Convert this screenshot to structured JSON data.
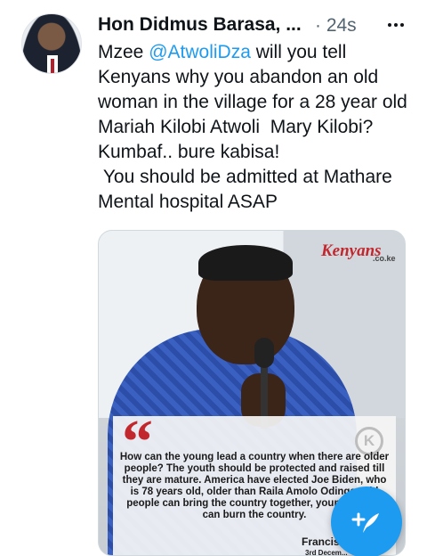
{
  "tweet": {
    "author_name": "Hon Didmus Barasa, ...",
    "time": "· 24s",
    "text_before": "Mzee ",
    "mention": "@AtwoliDza",
    "text_after": " will you tell Kenyans why you abandon an old woman in the village for a 28 year old Mariah Kilobi Atwoli  Mary Kilobi? Kumbaf.. bure kabisa!\n You should be admitted at Mathare Mental hospital ASAP"
  },
  "media": {
    "logo_main": "Kenyans",
    "logo_sub": ".co.ke",
    "quote_mark": "“",
    "badge_letter": "K",
    "quote": "How can the young lead a country when there are older people? The youth should be protected and raised till they are mature. America have elected Joe Biden, who is 78 years old, older than Raila Amolo Odinga. Old people can bring the country together, young people can burn the country.",
    "signature": "Francis",
    "date": "3rd Decem..."
  },
  "colors": {
    "accent": "#1d9bf0",
    "brand_red": "#c1272d"
  },
  "icons": {
    "more": "more-icon",
    "compose": "compose-tweet-icon"
  }
}
